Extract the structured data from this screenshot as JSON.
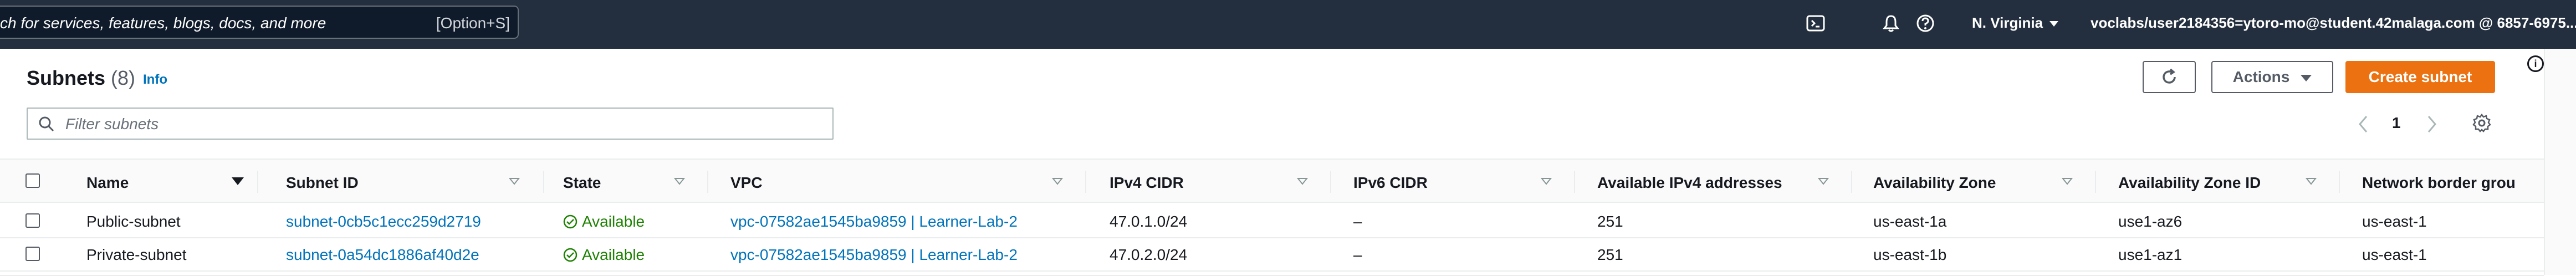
{
  "topnav": {
    "search_text": "ch for services, features, blogs, docs, and more",
    "search_shortcut": "[Option+S]",
    "region": "N. Virginia",
    "account": "voclabs/user2184356=ytoro-mo@student.42malaga.com @ 6857-6975..."
  },
  "panel": {
    "title": "Subnets",
    "count": "(8)",
    "info_label": "Info",
    "actions_label": "Actions",
    "create_label": "Create subnet",
    "filter_placeholder": "Filter subnets",
    "page_number": "1"
  },
  "table": {
    "columns": [
      "Name",
      "Subnet ID",
      "State",
      "VPC",
      "IPv4 CIDR",
      "IPv6 CIDR",
      "Available IPv4 addresses",
      "Availability Zone",
      "Availability Zone ID",
      "Network border grou"
    ],
    "rows": [
      {
        "name": "Public-subnet",
        "subnet_id": "subnet-0cb5c1ecc259d2719",
        "state": "Available",
        "vpc": "vpc-07582ae1545ba9859 | Learner-Lab-2",
        "ipv4": "47.0.1.0/24",
        "ipv6": "–",
        "available_ipv4": "251",
        "az": "us-east-1a",
        "az_id": "use1-az6",
        "border_group": "us-east-1"
      },
      {
        "name": "Private-subnet",
        "subnet_id": "subnet-0a54dc1886af40d2e",
        "state": "Available",
        "vpc": "vpc-07582ae1545ba9859 | Learner-Lab-2",
        "ipv4": "47.0.2.0/24",
        "ipv6": "–",
        "available_ipv4": "251",
        "az": "us-east-1b",
        "az_id": "use1-az1",
        "border_group": "us-east-1"
      }
    ]
  },
  "colors": {
    "nav_bg": "#232f3e",
    "link": "#0073bb",
    "primary_button": "#ec7211",
    "status_available": "#1d8102"
  },
  "icons": [
    "cloudshell-icon",
    "bell-icon",
    "help-icon",
    "refresh-icon",
    "search-icon",
    "chevron-left-icon",
    "chevron-right-icon",
    "gear-icon",
    "check-circle-icon",
    "info-icon"
  ]
}
